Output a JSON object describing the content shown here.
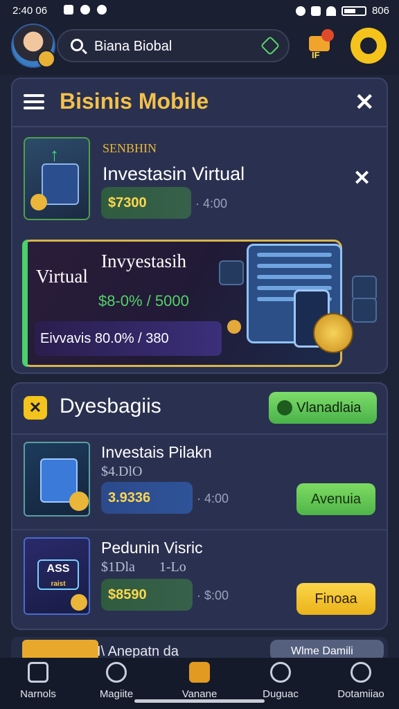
{
  "status_bar": {
    "time": "2:40 06",
    "right_text": "806"
  },
  "header": {
    "search_text": "Biana Biobal",
    "cart_text": "IF"
  },
  "card_top": {
    "title": "Bisinis Mobile",
    "featured": {
      "subtitle": "SENBHIN",
      "title": "Investasin Virtual",
      "amount": "$7300",
      "meta": "· 4:00"
    },
    "banner": {
      "title_line1": "Invyestasih",
      "title_line2": "Virtual",
      "amount": "$8-0% / 5000",
      "footer": "Eivvavis 80.0% / 380"
    }
  },
  "card_list": {
    "title": "Dyesbagiis",
    "top_button": "Vlanadlaia",
    "items": [
      {
        "title": "Investais Pilakn",
        "subtitle": "$4.DlO",
        "amount": "3.9336",
        "meta": "· 4:00",
        "button": "Avenuia",
        "button_color": "#5fc44f"
      },
      {
        "title": "Pedunin Visric",
        "subtitle": "$1Dla       1-Lo",
        "amount": "$8590",
        "meta": "· $:00",
        "button": "Finoaa",
        "button_color": "#f3c12b",
        "thumb_text_1": "ASS",
        "thumb_text_2": "raist"
      }
    ]
  },
  "peek_row": {
    "title": "I\\ Anepatn da",
    "button": "Wlme Damili"
  },
  "bottom_nav": [
    {
      "label": "Narnols",
      "icon": "home-icon"
    },
    {
      "label": "Magiite",
      "icon": "gamepad-icon"
    },
    {
      "label": "Vanane",
      "icon": "briefcase-icon"
    },
    {
      "label": "Duguac",
      "icon": "user-search-icon"
    },
    {
      "label": "Dotamiiao",
      "icon": "profile-icon"
    }
  ],
  "colors": {
    "background": "#1e2438",
    "card": "#2a3150",
    "accent_gold": "#f3c04a",
    "accent_green": "#5fc44f",
    "accent_yellow": "#f3c12b"
  }
}
